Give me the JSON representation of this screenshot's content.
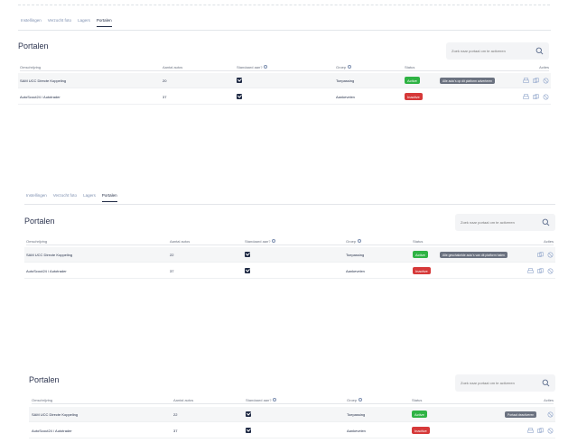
{
  "tabs": [
    {
      "label": "Instellingen"
    },
    {
      "label": "Verzocht foto"
    },
    {
      "label": "Lagers"
    },
    {
      "label": "Portalen"
    }
  ],
  "tabs_panel2": [
    {
      "label": "Instellingen"
    },
    {
      "label": "Verzocht foto"
    },
    {
      "label": "Lagers"
    },
    {
      "label": "Portalen"
    }
  ],
  "panel1": {
    "title": "Portalen",
    "search_placeholder": "Zoek naar portaal om te activeren",
    "columns": {
      "desc": "Omschrijving",
      "count": "Aantal autos",
      "std": "Standaard aan?",
      "reason": "Groep",
      "status": "Status",
      "actions": "Acties"
    },
    "rows": [
      {
        "desc": "SAM UCC Directe Koppeling",
        "count": "20",
        "reason": "Toepassing",
        "status": "Active"
      },
      {
        "desc": "AutoScout24 / Autotrader",
        "count": "37",
        "reason": "Aankevelen",
        "status": "Inactive"
      }
    ],
    "tooltip": "Alle auto's op dit platform adverteren"
  },
  "panel2": {
    "title": "Portalen",
    "search_placeholder": "Zoek naar portaal om te activeren",
    "columns": {
      "desc": "Omschrijving",
      "count": "Aantal autos",
      "std": "Standaard aan?",
      "reason": "Groep",
      "status": "Status",
      "actions": "Acties"
    },
    "rows": [
      {
        "desc": "SAM UCC Directe Koppeling",
        "count": "22",
        "reason": "Toepassing",
        "status": "Active"
      },
      {
        "desc": "AutoScout24 / Autotrader",
        "count": "37",
        "reason": "Aankevelen",
        "status": "Inactive"
      }
    ],
    "tooltip": "Alle geschakelde auto's van dit platform halen"
  },
  "panel3": {
    "title": "Portalen",
    "search_placeholder": "Zoek naar portaal om te activeren",
    "columns": {
      "desc": "Omschrijving",
      "count": "Aantal autos",
      "std": "Standaard aan?",
      "reason": "Groep",
      "status": "Status",
      "actions": "Acties"
    },
    "rows": [
      {
        "desc": "SAM UCC Directe Koppeling",
        "count": "22",
        "reason": "Toepassing",
        "status": "Active"
      },
      {
        "desc": "AutoScout24 / Autotrader",
        "count": "37",
        "reason": "Aankevelen",
        "status": "Inactive"
      }
    ],
    "tooltip": "Portaal deactiveren"
  },
  "colors": {
    "active": "#2fb344",
    "inactive": "#d63939",
    "navy": "#1f2a44",
    "accent": "#7d8fb0"
  },
  "icons": [
    "search-icon",
    "print-icon",
    "copy-icon",
    "ban-icon",
    "info-icon",
    "check-icon"
  ]
}
